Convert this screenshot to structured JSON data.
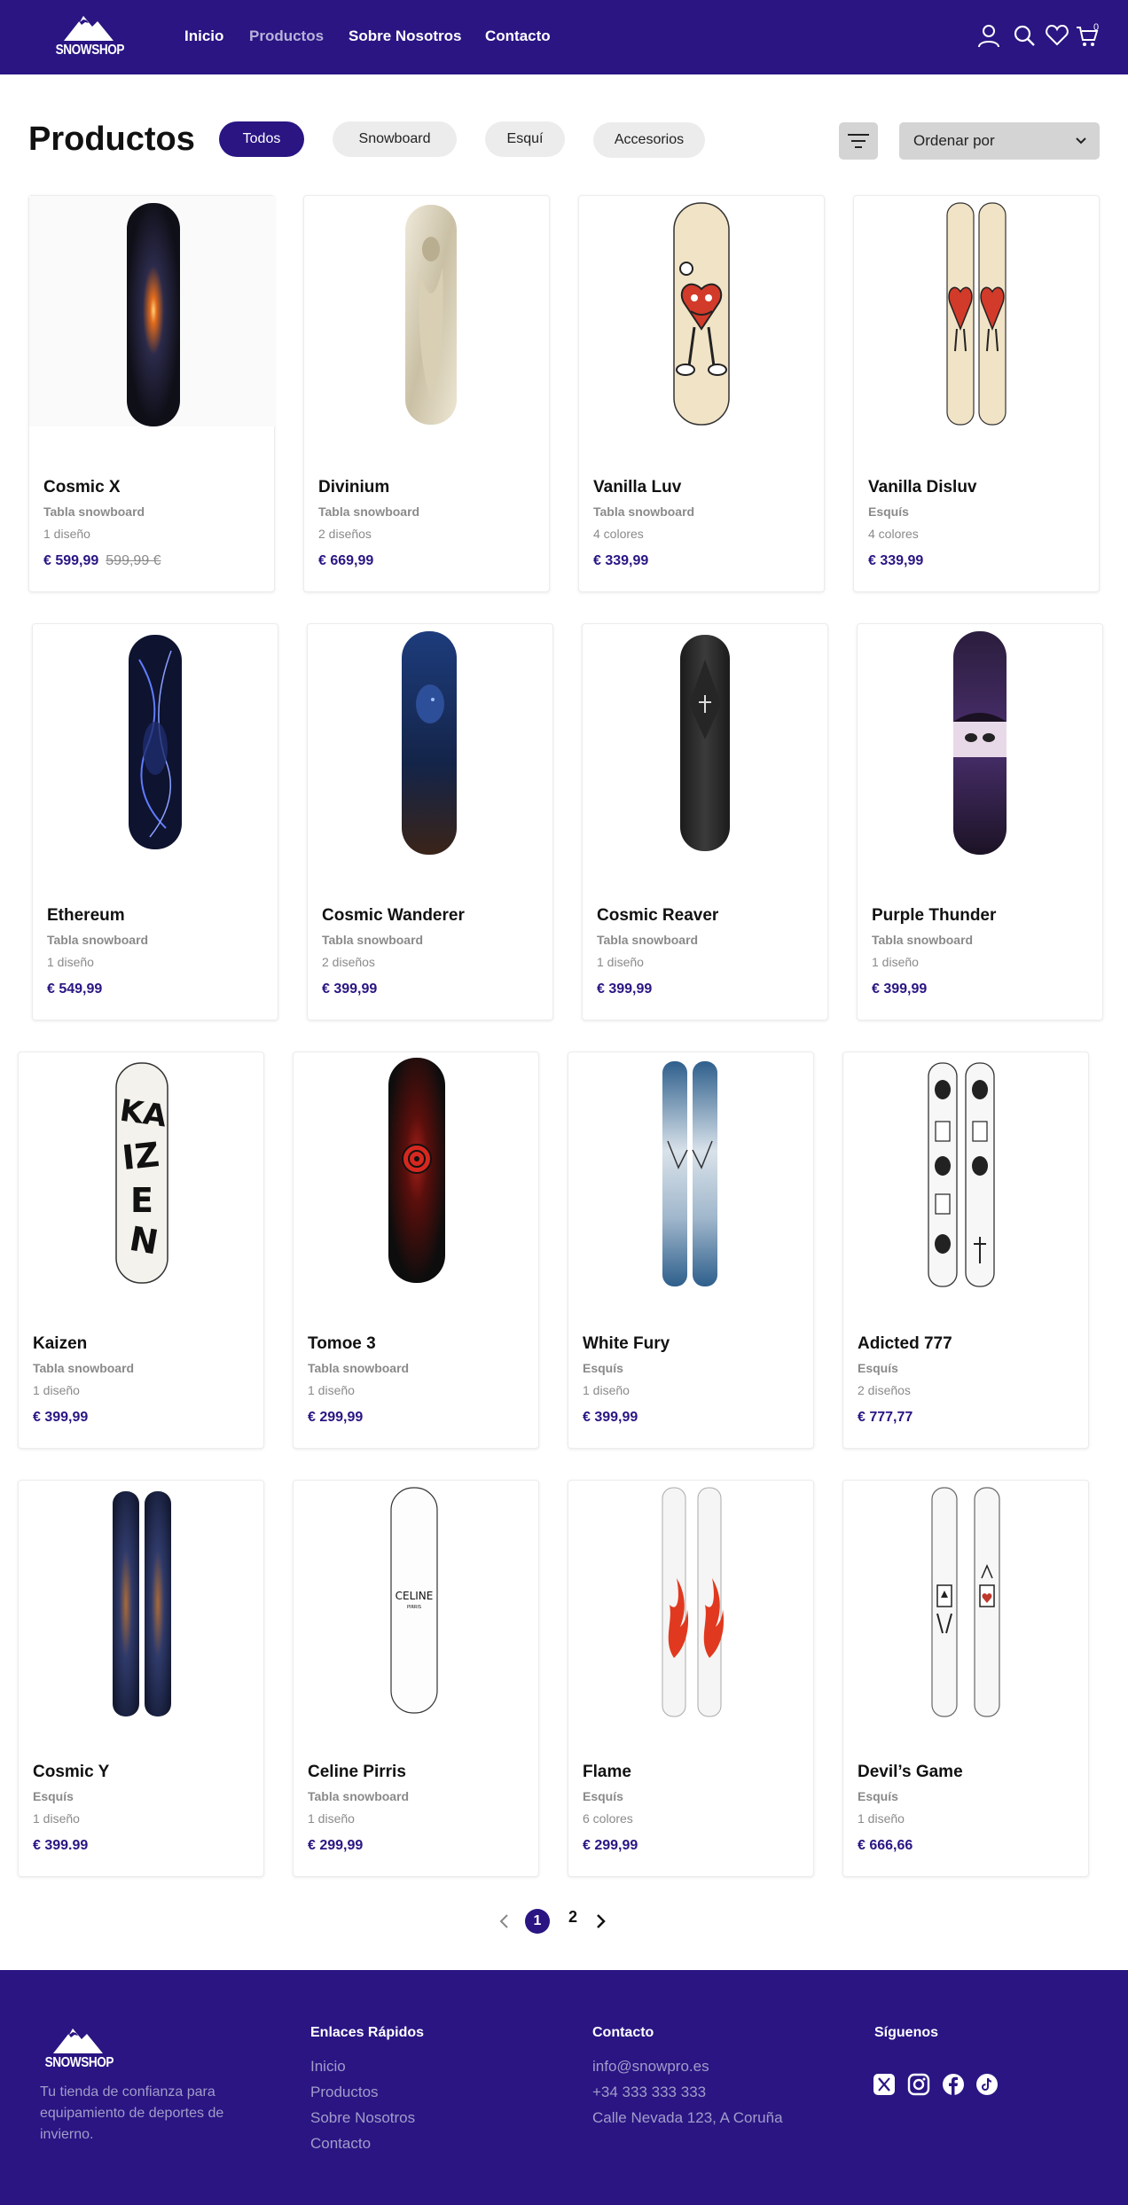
{
  "brand": {
    "name": "SNOWSHOP",
    "color": "#2a1583"
  },
  "nav": {
    "items": [
      {
        "label": "Inicio"
      },
      {
        "label": "Productos"
      },
      {
        "label": "Sobre Nosotros"
      },
      {
        "label": "Contacto"
      }
    ]
  },
  "header_icons": [
    "user-icon",
    "search-icon",
    "heart-icon",
    "cart-icon"
  ],
  "cart_count": "0",
  "page_title": "Productos",
  "filters": [
    {
      "label": "Todos",
      "active": true
    },
    {
      "label": "Snowboard"
    },
    {
      "label": "Esquí"
    },
    {
      "label": "Accesorios"
    }
  ],
  "sort": {
    "label": "Ordenar por"
  },
  "products": [
    {
      "name": "Cosmic X",
      "category": "Tabla snowboard",
      "variants": "1 diseño",
      "price": "€ 599,99",
      "old_price": "599,99 €"
    },
    {
      "name": "Divinium",
      "category": "Tabla snowboard",
      "variants": "2 diseños",
      "price": "€ 669,99"
    },
    {
      "name": "Vanilla Luv",
      "category": "Tabla snowboard",
      "variants": "4 colores",
      "price": "€ 339,99"
    },
    {
      "name": "Vanilla Disluv",
      "category": "Esquís",
      "variants": "4 colores",
      "price": "€ 339,99"
    },
    {
      "name": "Ethereum",
      "category": "Tabla snowboard",
      "variants": "1 diseño",
      "price": "€ 549,99"
    },
    {
      "name": "Cosmic Wanderer",
      "category": "Tabla snowboard",
      "variants": "2 diseños",
      "price": "€ 399,99"
    },
    {
      "name": "Cosmic Reaver",
      "category": "Tabla snowboard",
      "variants": "1 diseño",
      "price": "€ 399,99"
    },
    {
      "name": "Purple Thunder",
      "category": "Tabla snowboard",
      "variants": "1 diseño",
      "price": "€ 399,99"
    },
    {
      "name": "Kaizen",
      "category": "Tabla snowboard",
      "variants": "1 diseño",
      "price": "€ 399,99"
    },
    {
      "name": "Tomoe 3",
      "category": "Tabla snowboard",
      "variants": "1 diseño",
      "price": "€ 299,99"
    },
    {
      "name": "White Fury",
      "category": "Esquís",
      "variants": "1 diseño",
      "price": "€ 399,99"
    },
    {
      "name": "Adicted 777",
      "category": "Esquís",
      "variants": "2 diseños",
      "price": "€ 777,77"
    },
    {
      "name": "Cosmic Y",
      "category": "Esquís",
      "variants": "1 diseño",
      "price": "€ 399.99"
    },
    {
      "name": "Celine Pirris",
      "category": "Tabla snowboard",
      "variants": "1 diseño",
      "price": "€ 299,99",
      "board_text": "CELINE",
      "board_subtext": "PIRRIS"
    },
    {
      "name": "Flame",
      "category": "Esquís",
      "variants": "6 colores",
      "price": "€ 299,99"
    },
    {
      "name": "Devil’s Game",
      "category": "Esquís",
      "variants": "1 diseño",
      "price": "€ 666,66"
    }
  ],
  "pagination": {
    "pages": [
      "1",
      "2"
    ],
    "current": "1"
  },
  "footer": {
    "brand": "SNOWSHOP",
    "tagline": "Tu tienda de confianza para equipamiento de deportes de invierno.",
    "quick_links_title": "Enlaces Rápidos",
    "quick_links": [
      "Inicio",
      "Productos",
      "Sobre Nosotros",
      "Contacto"
    ],
    "contact_title": "Contacto",
    "contact": [
      "info@snowpro.es",
      "+34 333 333 333",
      "Calle Nevada 123, A Coruña"
    ],
    "social_title": "Síguenos",
    "social": [
      "x-icon",
      "instagram-icon",
      "facebook-icon",
      "tiktok-icon"
    ]
  }
}
